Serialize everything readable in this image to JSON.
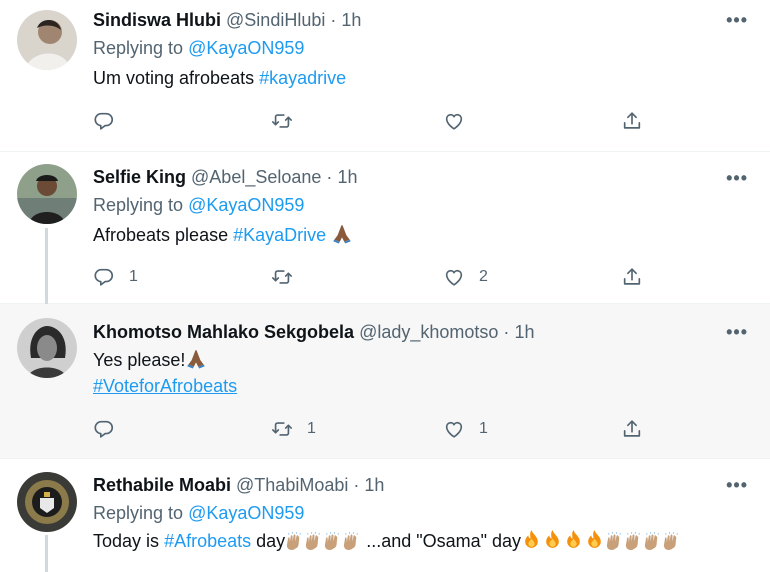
{
  "tweets": [
    {
      "name": "Sindiswa Hlubi",
      "handle": "@SindiHlubi",
      "dot": "·",
      "time": "1h",
      "reply_label": "Replying to",
      "reply_to": "@KayaON959",
      "text": "Um voting afrobeats",
      "hashtag": "#kayadrive",
      "counts": {
        "reply": "",
        "retweet": "",
        "like": ""
      }
    },
    {
      "name": "Selfie King",
      "handle": "@Abel_Seloane",
      "dot": "·",
      "time": "1h",
      "reply_label": "Replying to",
      "reply_to": "@KayaON959",
      "text": "Afrobeats please",
      "hashtag": "#KayaDrive",
      "counts": {
        "reply": "1",
        "retweet": "",
        "like": "2"
      }
    },
    {
      "name": "Khomotso Mahlako Sekgobela",
      "handle": "@lady_khomotso",
      "dot": "·",
      "time": "1h",
      "text": "Yes please!",
      "hashtag": "#VoteforAfrobeats",
      "counts": {
        "reply": "",
        "retweet": "1",
        "like": "1"
      }
    },
    {
      "name": "Rethabile Moabi",
      "handle": "@ThabiMoabi",
      "dot": "·",
      "time": "1h",
      "reply_label": "Replying to",
      "reply_to": "@KayaON959",
      "text_a": "Today is",
      "hashtag": "#Afrobeats",
      "text_b": "day",
      "text_c": "...and \"Osama\" day"
    }
  ],
  "more_glyph": "•••",
  "icons": {
    "reply": "reply-icon",
    "retweet": "retweet-icon",
    "like": "heart-icon",
    "share": "share-icon",
    "emoji_pray": "folded-hands-emoji",
    "emoji_clap": "raised-hands-emoji",
    "emoji_fire": "fire-emoji"
  },
  "colors": {
    "link": "#1d9bf0",
    "muted": "#536471",
    "highlight_bg": "#f7f7f7",
    "thread_line": "#cfd9de"
  }
}
